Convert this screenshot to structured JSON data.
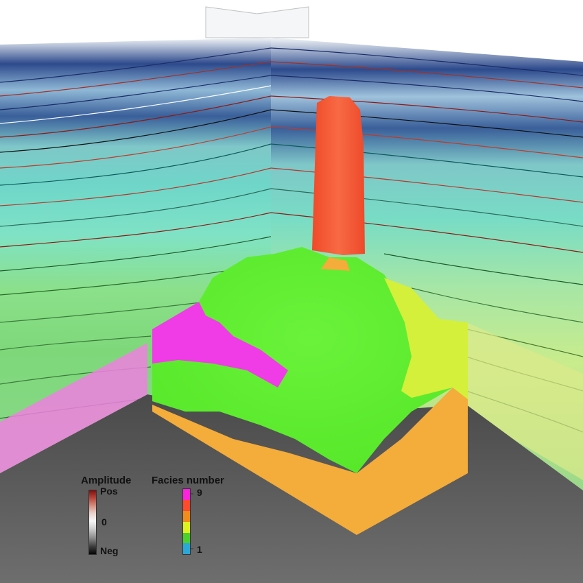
{
  "legend": {
    "amplitude": {
      "title": "Amplitude",
      "max_label": "Pos",
      "zero_label": "0",
      "min_label": "Neg",
      "colors": [
        "#7a1212",
        "#d48f80",
        "#f7f7f7",
        "#8e8e8e",
        "#050505"
      ]
    },
    "facies": {
      "title": "Facies number",
      "max_label": "9",
      "min_label": "1",
      "colors": [
        "#ff22dd",
        "#ff4a2c",
        "#f28c1a",
        "#ddf21f",
        "#4bd02c",
        "#2aa8d8"
      ]
    }
  },
  "scene": {
    "floor_color": "#5a5a5a",
    "body_top_color": "#63ef2b",
    "body_side_color": "#f4ac3a",
    "chimney_color": "#f5532f",
    "pink_facies_color": "#f03ce6",
    "yellow_facies_color": "#d4f03a"
  }
}
